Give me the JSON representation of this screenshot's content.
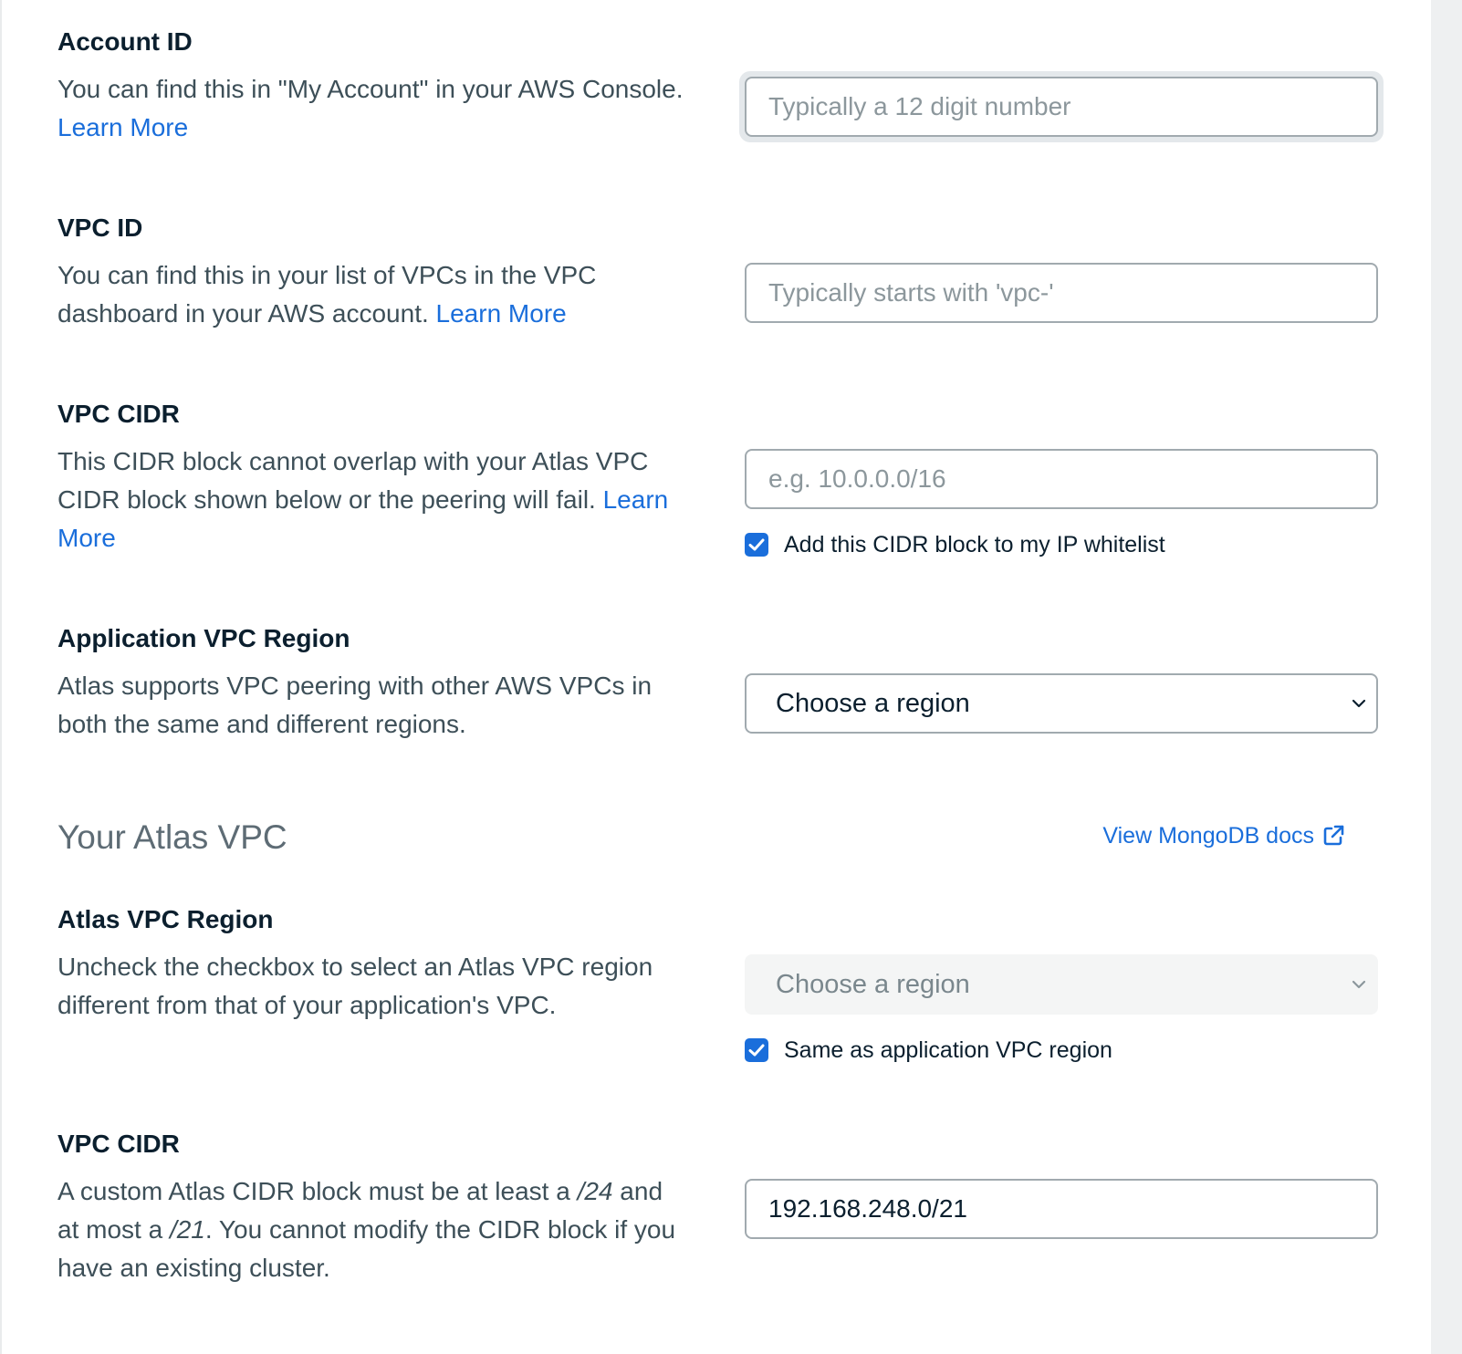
{
  "account_id": {
    "label": "Account ID",
    "description": "You can find this in \"My Account\" in your AWS Console. ",
    "link": "Learn More",
    "placeholder": "Typically a 12 digit number",
    "value": ""
  },
  "vpc_id": {
    "label": "VPC ID",
    "description": "You can find this in your list of VPCs in the VPC dashboard in your AWS account. ",
    "link": "Learn More",
    "placeholder": "Typically starts with 'vpc-'",
    "value": ""
  },
  "vpc_cidr": {
    "label": "VPC CIDR",
    "description": "This CIDR block cannot overlap with your Atlas VPC CIDR block shown below or the peering will fail. ",
    "link": "Learn More",
    "placeholder": "e.g. 10.0.0.0/16",
    "value": "",
    "checkbox_label": "Add this CIDR block to my IP whitelist",
    "checkbox_checked": true
  },
  "app_region": {
    "label": "Application VPC Region",
    "description": "Atlas supports VPC peering with other AWS VPCs in both the same and different regions.",
    "selected": "Choose a region"
  },
  "atlas_section": {
    "title": "Your Atlas VPC",
    "docs_link": "View MongoDB docs"
  },
  "atlas_region": {
    "label": "Atlas VPC Region",
    "description": "Uncheck the checkbox to select an Atlas VPC region different from that of your application's VPC.",
    "selected": "Choose a region",
    "disabled": true,
    "checkbox_label": "Same as application VPC region",
    "checkbox_checked": true
  },
  "atlas_cidr": {
    "label": "VPC CIDR",
    "desc_part1": "A custom Atlas CIDR block must be at least a ",
    "desc_em1": "/24",
    "desc_part2": " and at most a ",
    "desc_em2": "/21",
    "desc_part3": ". You cannot modify the CIDR block if you have an existing cluster.",
    "value": "192.168.248.0/21"
  },
  "colors": {
    "link": "#1a6edb",
    "heading": "#0b1f2e",
    "body_text": "#3d4f58",
    "input_border": "#a1aaaf",
    "checkbox": "#1a6edb",
    "disabled_bg": "#f4f5f5"
  },
  "icons": {
    "chevron": "chevron-down-icon",
    "checkmark": "checkmark-icon",
    "external_link": "external-link-icon"
  }
}
